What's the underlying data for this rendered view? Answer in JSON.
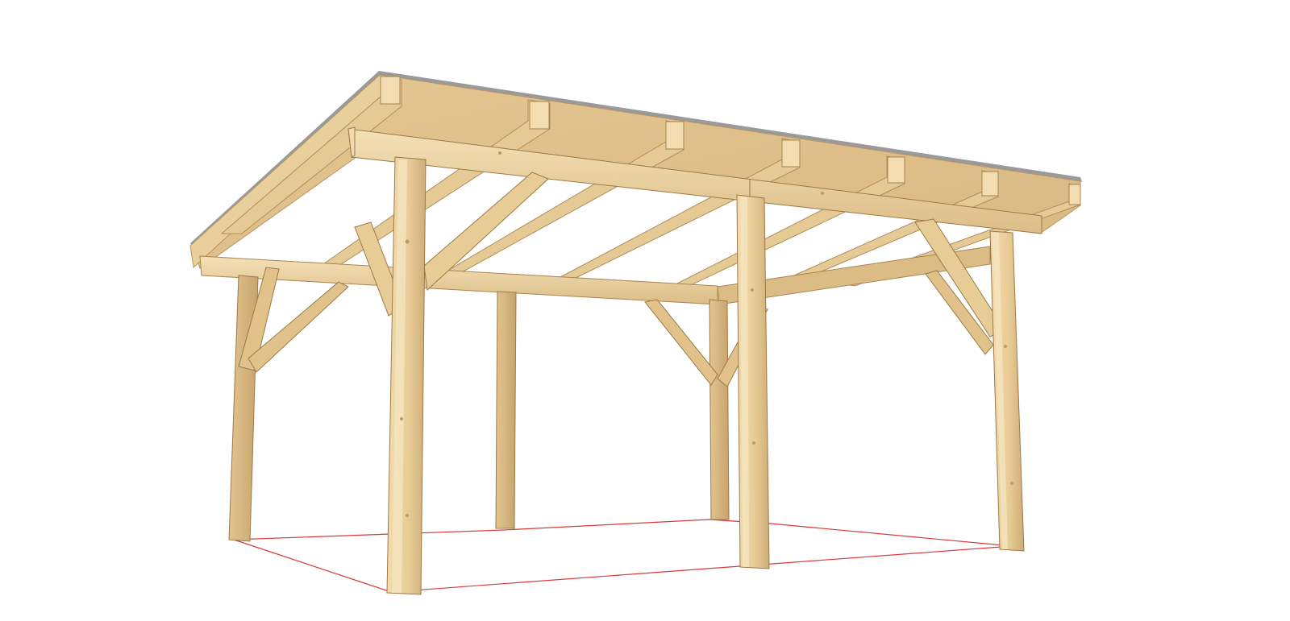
{
  "scene": {
    "subject": "carport-timber-frame",
    "colors": {
      "background": "#ffffff",
      "wood_light": "#ecd3a2",
      "wood_mid": "#dcbd86",
      "wood_dark": "#c49e66",
      "edge": "#8a6a3f",
      "roof_metal": "#9a9a9a",
      "ground_outline": "#d63a3a"
    }
  }
}
